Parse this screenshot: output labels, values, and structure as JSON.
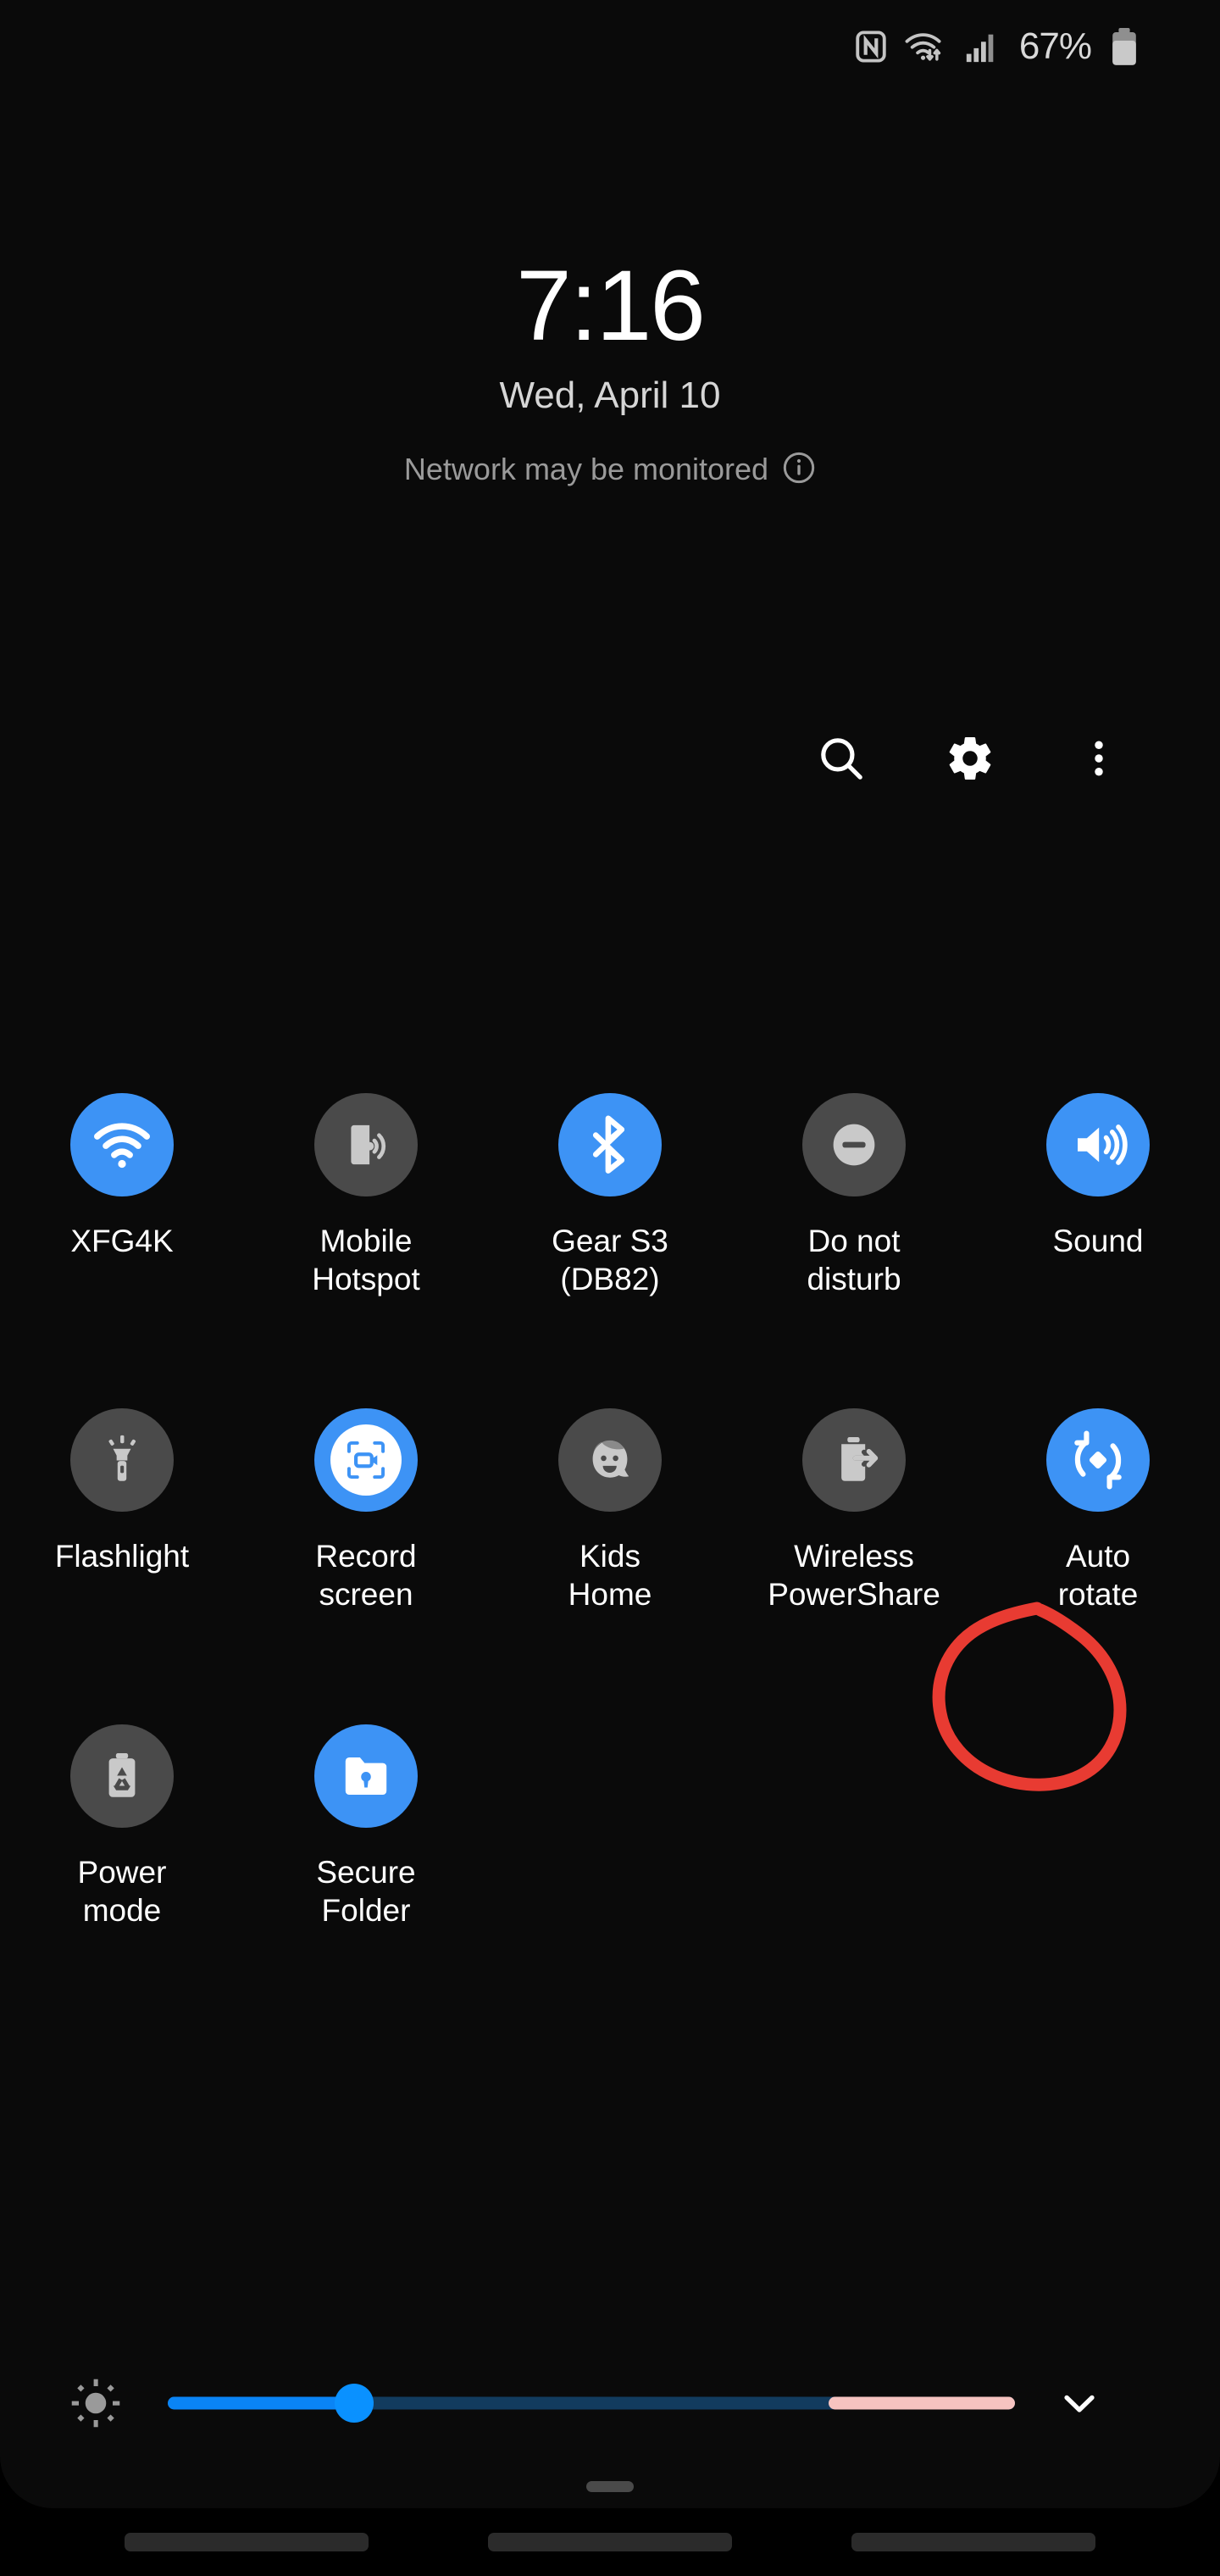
{
  "statusbar": {
    "nfc_icon": "nfc-icon",
    "wifi_icon": "wifi-transfer-icon",
    "signal_icon": "cellular-signal-icon",
    "battery_percent": "67%",
    "battery_icon": "battery-icon"
  },
  "clock": {
    "time": "7:16",
    "date": "Wed, April 10",
    "notice": "Network may be monitored",
    "notice_icon": "info-icon"
  },
  "header_actions": [
    {
      "name": "search-button",
      "icon": "search-icon"
    },
    {
      "name": "settings-button",
      "icon": "gear-icon"
    },
    {
      "name": "more-options-button",
      "icon": "overflow-menu-icon"
    }
  ],
  "tiles": [
    {
      "label": "XFG4K",
      "icon": "wifi-icon",
      "state": "on"
    },
    {
      "label": "Mobile\nHotspot",
      "icon": "mobile-hotspot-icon",
      "state": "off"
    },
    {
      "label": "Gear S3\n(DB82)",
      "icon": "bluetooth-icon",
      "state": "on"
    },
    {
      "label": "Do not\ndisturb",
      "icon": "do-not-disturb-icon",
      "state": "off"
    },
    {
      "label": "Sound",
      "icon": "sound-icon",
      "state": "on"
    },
    {
      "label": "Flashlight",
      "icon": "flashlight-icon",
      "state": "off"
    },
    {
      "label": "Record\nscreen",
      "icon": "record-screen-icon",
      "state": "on"
    },
    {
      "label": "Kids\nHome",
      "icon": "kids-home-icon",
      "state": "off"
    },
    {
      "label": "Wireless\nPowerShare",
      "icon": "wireless-powershare-icon",
      "state": "off"
    },
    {
      "label": "Auto\nrotate",
      "icon": "auto-rotate-icon",
      "state": "on"
    },
    {
      "label": "Power\nmode",
      "icon": "power-mode-icon",
      "state": "off"
    },
    {
      "label": "Secure\nFolder",
      "icon": "secure-folder-icon",
      "state": "on"
    }
  ],
  "annotation": {
    "shape": "hand-drawn-circle",
    "target": "Auto rotate",
    "color": "#e83b32"
  },
  "brightness": {
    "icon": "brightness-icon",
    "value_percent": 22,
    "expand_icon": "chevron-down-icon"
  },
  "colors": {
    "accent_on": "#3d93f5",
    "tile_off": "#4a4a4a",
    "slider_fill": "#0a84f5",
    "slider_track": "#123b5e",
    "slider_extra": "#f6c3c0",
    "annotation_red": "#e83b32",
    "panel_bg": "#0a0a0a"
  },
  "navbar": {
    "drag_handle": "panel-drag-handle",
    "pills": [
      "nav-pill-recents",
      "nav-pill-home",
      "nav-pill-back"
    ]
  }
}
